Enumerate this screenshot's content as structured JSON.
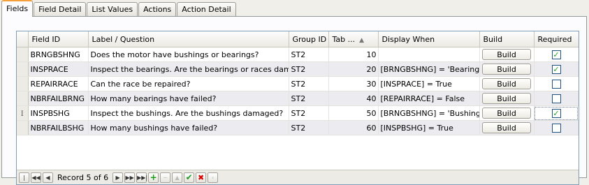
{
  "tabs": [
    {
      "label": "Fields",
      "active": true
    },
    {
      "label": "Field Detail",
      "active": false
    },
    {
      "label": "List Values",
      "active": false
    },
    {
      "label": "Actions",
      "active": false
    },
    {
      "label": "Action Detail",
      "active": false
    }
  ],
  "grid": {
    "columns": {
      "field_id": "Field ID",
      "label": "Label / Question",
      "group_id": "Group ID",
      "tab": "Tab ...",
      "display_when": "Display When",
      "build": "Build",
      "required": "Required"
    },
    "rows": [
      {
        "field_id": "BRNGBSHNG",
        "label": "Does the motor have bushings or bearings?",
        "group_id": "ST2",
        "tab": "10",
        "display_when": "",
        "build": "Build",
        "required": true
      },
      {
        "field_id": "INSPRACE",
        "label": "Inspect the bearings. Are the bearings or races damaged?",
        "group_id": "ST2",
        "tab": "20",
        "display_when": "[BRNGBSHNG] = 'Bearings'",
        "build": "Build",
        "required": true
      },
      {
        "field_id": "REPAIRRACE",
        "label": "Can the race be repaired?",
        "group_id": "ST2",
        "tab": "30",
        "display_when": "[INSPRACE] = True",
        "build": "Build",
        "required": false
      },
      {
        "field_id": "NBRFAILBRNG",
        "label": "How many bearings have failed?",
        "group_id": "ST2",
        "tab": "40",
        "display_when": "[REPAIRRACE] = False",
        "build": "Build",
        "required": false
      },
      {
        "field_id": "INSPBSHG",
        "label": "Inspect the bushings. Are the bushings damaged?",
        "group_id": "ST2",
        "tab": "50",
        "display_when": "[BRNGBSHNG] = 'Bushings'",
        "build": "Build",
        "required": true
      },
      {
        "field_id": "NBRFAILBSHG",
        "label": "How many bushings have failed?",
        "group_id": "ST2",
        "tab": "60",
        "display_when": "[INSPBSHG] = True",
        "build": "Build",
        "required": false
      }
    ]
  },
  "navigator": {
    "record_text": "Record 5 of 6",
    "icons": [
      "first-icon",
      "prev-page-icon",
      "prev-icon",
      "next-icon",
      "next-page-icon",
      "last-icon",
      "add-icon",
      "delete-icon",
      "edit-icon",
      "post-icon",
      "cancel-icon",
      "refresh-icon"
    ]
  },
  "colors": {
    "tab_highlight": "#f6a03c",
    "grid_border": "#7f9db9",
    "check_green": "#21a121"
  }
}
